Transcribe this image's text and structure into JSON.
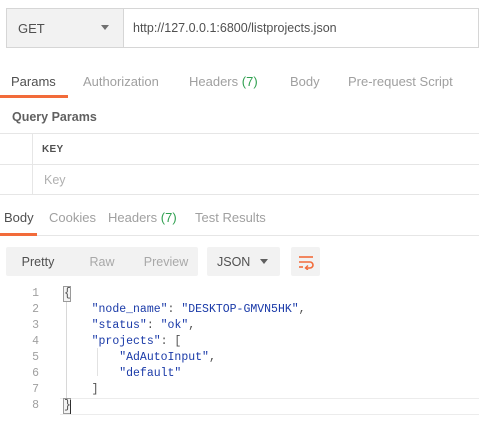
{
  "request": {
    "method": "GET",
    "url": "http://127.0.0.1:6800/listprojects.json"
  },
  "request_tabs": [
    {
      "label": "Params",
      "count": ""
    },
    {
      "label": "Authorization",
      "count": ""
    },
    {
      "label": "Headers",
      "count": "(7)"
    },
    {
      "label": "Body",
      "count": ""
    },
    {
      "label": "Pre-request Script",
      "count": ""
    }
  ],
  "query_params": {
    "title": "Query Params",
    "key_header": "KEY",
    "key_placeholder": "Key"
  },
  "response_tabs": [
    {
      "label": "Body",
      "count": ""
    },
    {
      "label": "Cookies",
      "count": ""
    },
    {
      "label": "Headers",
      "count": "(7)"
    },
    {
      "label": "Test Results",
      "count": ""
    }
  ],
  "body_view": {
    "modes": [
      "Pretty",
      "Raw",
      "Preview"
    ],
    "format": "JSON",
    "wrap_icon": "wrap-lines-icon"
  },
  "code_lines": [
    {
      "n": "1",
      "parts": [
        [
          "p",
          "{"
        ]
      ]
    },
    {
      "n": "2",
      "parts": [
        [
          "p",
          "    "
        ],
        [
          "k",
          "\"node_name\""
        ],
        [
          "p",
          ": "
        ],
        [
          "s",
          "\"DESKTOP-GMVN5HK\""
        ],
        [
          "p",
          ","
        ]
      ]
    },
    {
      "n": "3",
      "parts": [
        [
          "p",
          "    "
        ],
        [
          "k",
          "\"status\""
        ],
        [
          "p",
          ": "
        ],
        [
          "s",
          "\"ok\""
        ],
        [
          "p",
          ","
        ]
      ]
    },
    {
      "n": "4",
      "parts": [
        [
          "p",
          "    "
        ],
        [
          "k",
          "\"projects\""
        ],
        [
          "p",
          ": ["
        ]
      ]
    },
    {
      "n": "5",
      "parts": [
        [
          "p",
          "        "
        ],
        [
          "s",
          "\"AdAutoInput\""
        ],
        [
          "p",
          ","
        ]
      ]
    },
    {
      "n": "6",
      "parts": [
        [
          "p",
          "        "
        ],
        [
          "s",
          "\"default\""
        ]
      ]
    },
    {
      "n": "7",
      "parts": [
        [
          "p",
          "    ]"
        ]
      ]
    },
    {
      "n": "8",
      "parts": [
        [
          "p",
          "}"
        ]
      ]
    }
  ],
  "colors": {
    "accent": "#f26b3a",
    "count": "#30a050",
    "json_key": "#1a3aa8"
  }
}
